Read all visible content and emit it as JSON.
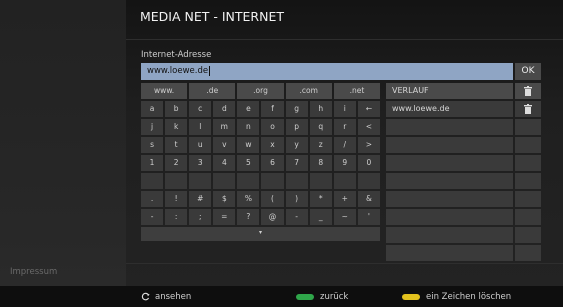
{
  "title": "MEDIA NET - INTERNET",
  "sidebar": {
    "impressum": "Impressum"
  },
  "url": {
    "label": "Internet-Adresse",
    "value": "www.loewe.de",
    "ok_label": "OK"
  },
  "keyboard": {
    "top_row": [
      "www.",
      ".de",
      ".org",
      ".com",
      ".net"
    ],
    "rows": [
      [
        "a",
        "b",
        "c",
        "d",
        "e",
        "f",
        "g",
        "h",
        "i",
        "←"
      ],
      [
        "j",
        "k",
        "l",
        "m",
        "n",
        "o",
        "p",
        "q",
        "r",
        "<"
      ],
      [
        "s",
        "t",
        "u",
        "v",
        "w",
        "x",
        "y",
        "z",
        "/",
        ">"
      ],
      [
        "1",
        "2",
        "3",
        "4",
        "5",
        "6",
        "7",
        "8",
        "9",
        "0"
      ],
      [
        "",
        "",
        "",
        "",
        "",
        "",
        "",
        "",
        "",
        ""
      ],
      [
        ".",
        "!",
        "#",
        "$",
        "%",
        "(",
        ")",
        "*",
        "+",
        "&"
      ],
      [
        "-",
        ":",
        ";",
        "=",
        "?",
        "@",
        "-",
        "_",
        "~",
        "'"
      ]
    ],
    "more_indicator": "▾"
  },
  "history": {
    "header": "VERLAUF",
    "items": [
      "www.loewe.de"
    ],
    "empty_rows": 8
  },
  "footer": {
    "hints": [
      {
        "icon": "refresh-icon",
        "label": "ansehen"
      },
      {
        "icon": "green-button-icon",
        "color": "#2fa64a",
        "label": "zurück"
      },
      {
        "icon": "yellow-button-icon",
        "color": "#e3c21d",
        "label": "ein Zeichen löschen"
      }
    ]
  },
  "colors": {
    "url_bg": "#8fa5c4",
    "accent_green": "#2fa64a",
    "accent_yellow": "#e3c21d"
  }
}
